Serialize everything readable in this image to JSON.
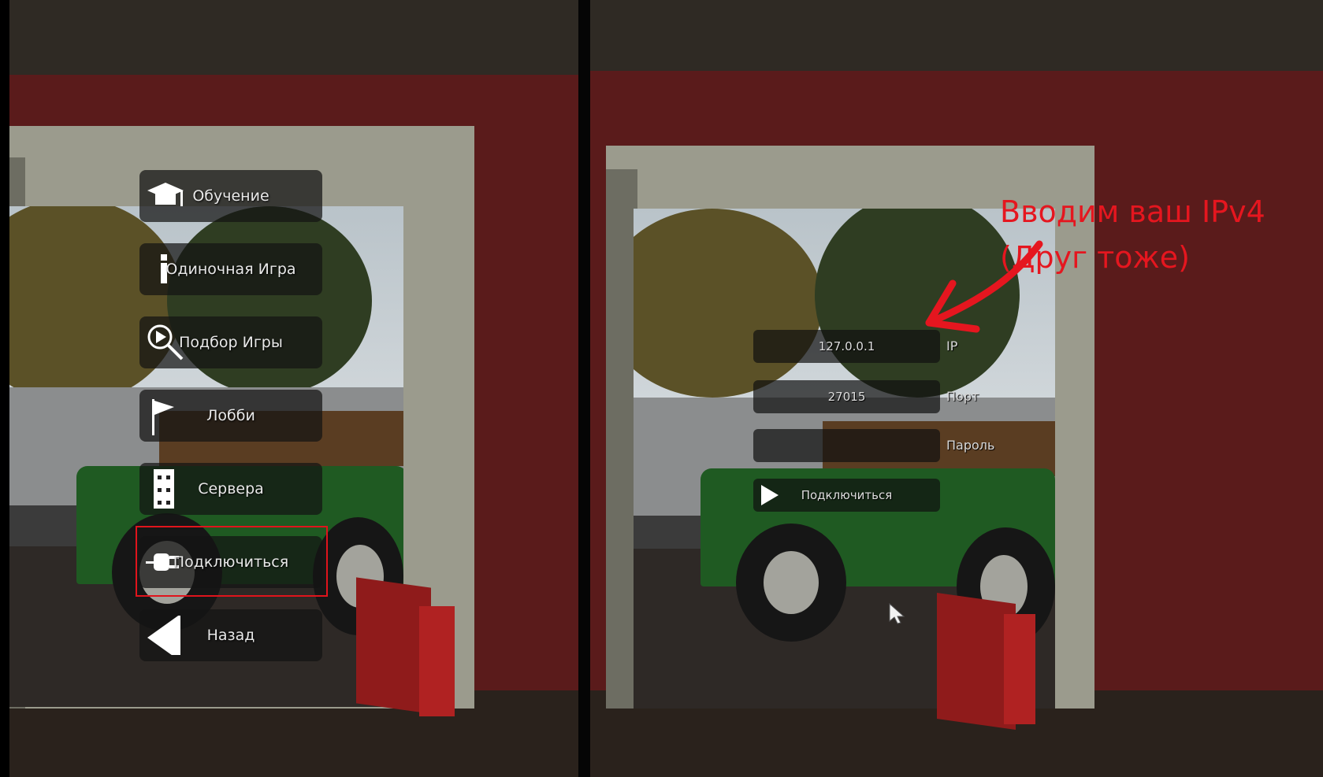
{
  "left_panel": {
    "menu_items": [
      {
        "label": "Обучение",
        "icon": "graduation-cap-icon"
      },
      {
        "label": "Одиночная Игра",
        "icon": "single-player-icon"
      },
      {
        "label": "Подбор Игры",
        "icon": "magnifier-play-icon"
      },
      {
        "label": "Лобби",
        "icon": "flag-icon"
      },
      {
        "label": "Сервера",
        "icon": "server-icon"
      },
      {
        "label": "Подключиться",
        "icon": "plug-icon"
      },
      {
        "label": "Назад",
        "icon": "back-arrow-icon"
      }
    ],
    "highlight_color": "#e0141c"
  },
  "right_panel": {
    "ip_field": {
      "value": "127.0.0.1",
      "label": "IP"
    },
    "port_field": {
      "value": "27015",
      "label": "Порт"
    },
    "password_field": {
      "value": "",
      "label": "Пароль"
    },
    "connect_button": {
      "label": "Подключиться",
      "icon": "play-icon"
    },
    "annotation": {
      "line1": "Вводим ваш IPv4",
      "line2": "(Друг тоже)",
      "color": "#e5161f"
    }
  }
}
